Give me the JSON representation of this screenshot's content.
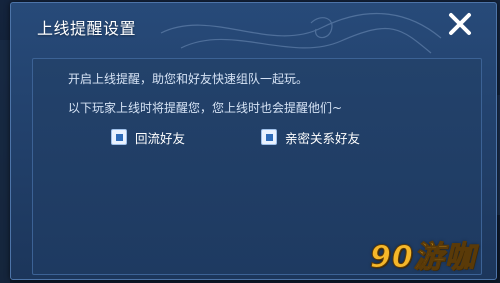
{
  "dialog": {
    "title": "上线提醒设置",
    "close_icon": "close-x-icon",
    "description_line1": "开启上线提醒，助您和好友快速组队一起玩。",
    "description_line2": "以下玩家上线时将提醒您，您上线时也会提醒他们~",
    "options": [
      {
        "label": "回流好友",
        "checked": true
      },
      {
        "label": "亲密关系好友",
        "checked": true
      }
    ]
  },
  "watermark": "90游咖",
  "colors": {
    "dialog_bg": "#22416c",
    "panel_bg": "#1e3a61",
    "title_text": "#ffffff",
    "body_text": "#d6e3f5",
    "checkbox_mark": "#2f6cb8",
    "watermark": "#f5b72a"
  }
}
